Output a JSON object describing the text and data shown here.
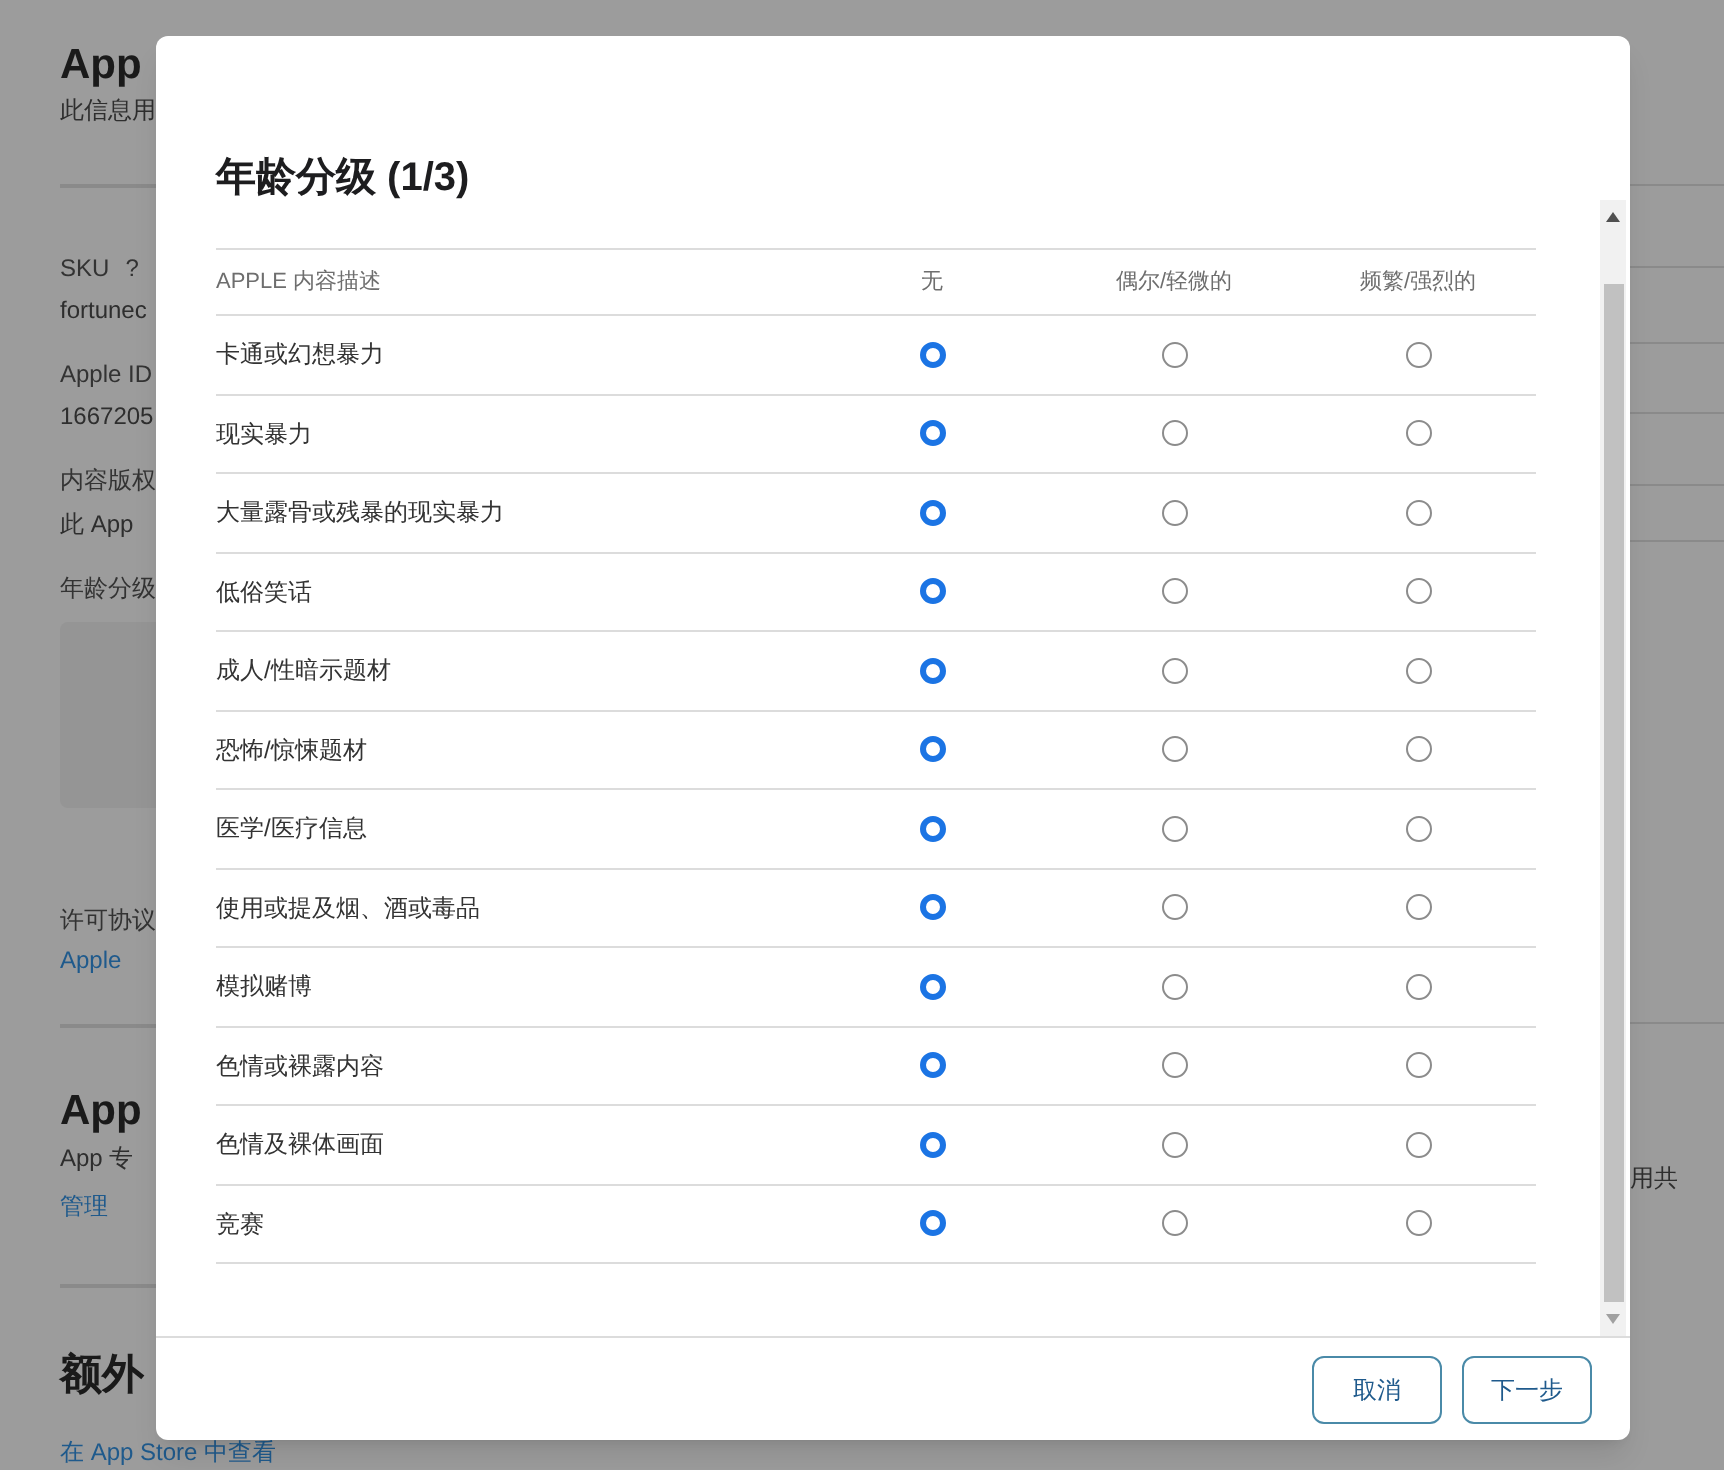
{
  "background": {
    "items": [
      {
        "kind": "heading",
        "text": "App"
      },
      {
        "kind": "text",
        "text": "此信息用"
      },
      {
        "kind": "divider"
      },
      {
        "kind": "label",
        "text": "SKU",
        "help": "?"
      },
      {
        "kind": "text",
        "text": "fortunec"
      },
      {
        "kind": "label",
        "text": "Apple ID"
      },
      {
        "kind": "text",
        "text": "1667205"
      },
      {
        "kind": "label",
        "text": "内容版权"
      },
      {
        "kind": "text",
        "text": "此 App"
      },
      {
        "kind": "label",
        "text": "年龄分级"
      },
      {
        "kind": "box"
      },
      {
        "kind": "label",
        "text": "许可协议"
      },
      {
        "kind": "link",
        "text": "Apple"
      },
      {
        "kind": "divider"
      },
      {
        "kind": "heading",
        "text": "App"
      },
      {
        "kind": "text",
        "text": "App 专"
      },
      {
        "kind": "link",
        "text": "管理"
      },
      {
        "kind": "divider"
      },
      {
        "kind": "heading",
        "text": "额外"
      },
      {
        "kind": "link",
        "text": "在 App Store 中查看"
      }
    ],
    "right_text": "用共"
  },
  "modal": {
    "title": "年龄分级 (1/3)",
    "columns": [
      "APPLE 内容描述",
      "无",
      "偶尔/轻微的",
      "频繁/强烈的"
    ],
    "rows": [
      {
        "label": "卡通或幻想暴力",
        "options": [
          {
            "selected": true
          },
          {
            "selected": false
          },
          {
            "selected": false
          }
        ]
      },
      {
        "label": "现实暴力",
        "options": [
          {
            "selected": true
          },
          {
            "selected": false
          },
          {
            "selected": false
          }
        ]
      },
      {
        "label": "大量露骨或残暴的现实暴力",
        "options": [
          {
            "selected": true
          },
          {
            "selected": false
          },
          {
            "selected": false
          }
        ]
      },
      {
        "label": "低俗笑话",
        "options": [
          {
            "selected": true
          },
          {
            "selected": false
          },
          {
            "selected": false
          }
        ]
      },
      {
        "label": "成人/性暗示题材",
        "options": [
          {
            "selected": true
          },
          {
            "selected": false
          },
          {
            "selected": false
          }
        ]
      },
      {
        "label": "恐怖/惊悚题材",
        "options": [
          {
            "selected": true
          },
          {
            "selected": false
          },
          {
            "selected": false
          }
        ]
      },
      {
        "label": "医学/医疗信息",
        "options": [
          {
            "selected": true
          },
          {
            "selected": false
          },
          {
            "selected": false
          }
        ]
      },
      {
        "label": "使用或提及烟、酒或毒品",
        "options": [
          {
            "selected": true
          },
          {
            "selected": false
          },
          {
            "selected": false
          }
        ]
      },
      {
        "label": "模拟赌博",
        "options": [
          {
            "selected": true
          },
          {
            "selected": false
          },
          {
            "selected": false
          }
        ]
      },
      {
        "label": "色情或裸露内容",
        "options": [
          {
            "selected": true
          },
          {
            "selected": false
          },
          {
            "selected": false
          }
        ]
      },
      {
        "label": "色情及裸体画面",
        "options": [
          {
            "selected": true
          },
          {
            "selected": false
          },
          {
            "selected": false
          }
        ]
      },
      {
        "label": "竞赛",
        "options": [
          {
            "selected": true
          },
          {
            "selected": false
          },
          {
            "selected": false
          }
        ]
      }
    ],
    "buttons": [
      "取消",
      "下一步"
    ]
  }
}
